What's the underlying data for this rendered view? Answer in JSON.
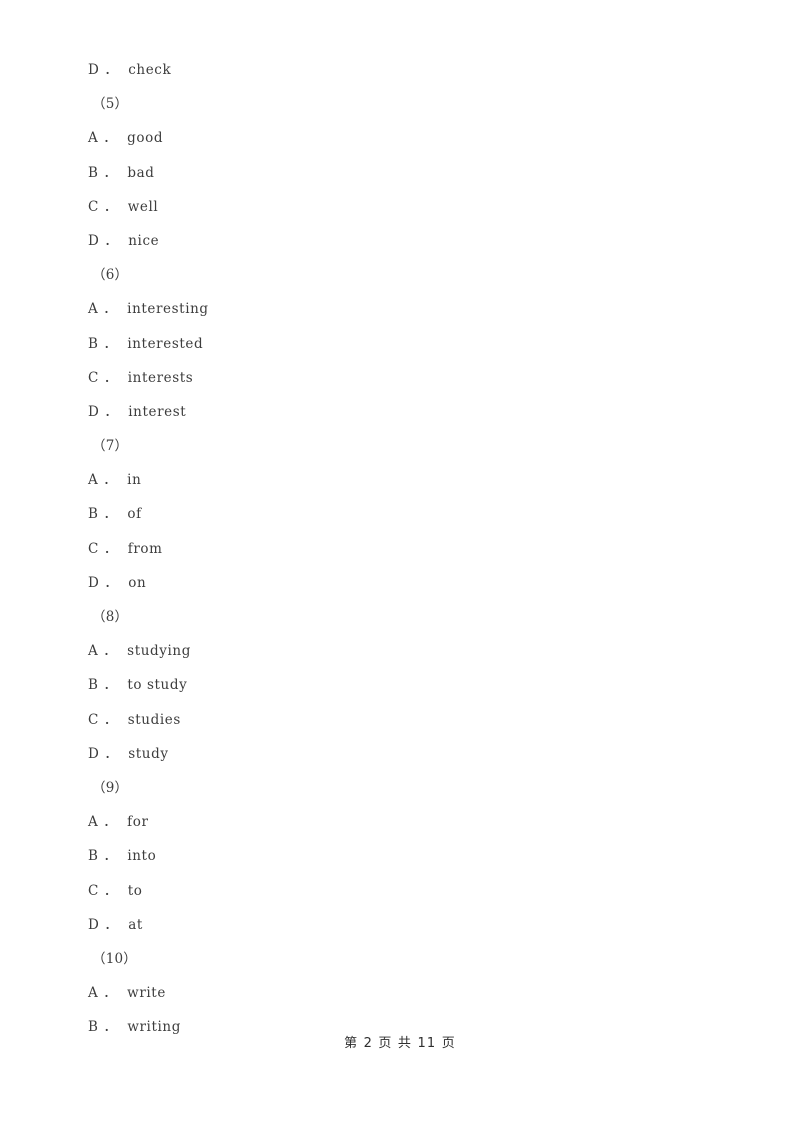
{
  "document": {
    "type": "exam-paper",
    "page_background": "#ffffff",
    "text_color": "#3d3d3d",
    "footer_color": "#2f2f2f"
  },
  "body": {
    "lines": [
      {
        "kind": "option",
        "letter": "D",
        "separator": "．",
        "text": "check"
      },
      {
        "kind": "group",
        "label": "（5）"
      },
      {
        "kind": "option",
        "letter": "A",
        "separator": "．",
        "text": "good"
      },
      {
        "kind": "option",
        "letter": "B",
        "separator": "．",
        "text": "bad"
      },
      {
        "kind": "option",
        "letter": "C",
        "separator": "．",
        "text": "well"
      },
      {
        "kind": "option",
        "letter": "D",
        "separator": "．",
        "text": "nice"
      },
      {
        "kind": "group",
        "label": "（6）"
      },
      {
        "kind": "option",
        "letter": "A",
        "separator": "．",
        "text": "interesting"
      },
      {
        "kind": "option",
        "letter": "B",
        "separator": "．",
        "text": "interested"
      },
      {
        "kind": "option",
        "letter": "C",
        "separator": "．",
        "text": "interests"
      },
      {
        "kind": "option",
        "letter": "D",
        "separator": "．",
        "text": "interest"
      },
      {
        "kind": "group",
        "label": "（7）"
      },
      {
        "kind": "option",
        "letter": "A",
        "separator": "．",
        "text": "in"
      },
      {
        "kind": "option",
        "letter": "B",
        "separator": "．",
        "text": "of"
      },
      {
        "kind": "option",
        "letter": "C",
        "separator": "．",
        "text": "from"
      },
      {
        "kind": "option",
        "letter": "D",
        "separator": "．",
        "text": "on"
      },
      {
        "kind": "group",
        "label": "（8）"
      },
      {
        "kind": "option",
        "letter": "A",
        "separator": "．",
        "text": "studying"
      },
      {
        "kind": "option",
        "letter": "B",
        "separator": "．",
        "text": "to study"
      },
      {
        "kind": "option",
        "letter": "C",
        "separator": "．",
        "text": "studies"
      },
      {
        "kind": "option",
        "letter": "D",
        "separator": "．",
        "text": "study"
      },
      {
        "kind": "group",
        "label": "（9）"
      },
      {
        "kind": "option",
        "letter": "A",
        "separator": "．",
        "text": "for"
      },
      {
        "kind": "option",
        "letter": "B",
        "separator": "．",
        "text": "into"
      },
      {
        "kind": "option",
        "letter": "C",
        "separator": "．",
        "text": "to"
      },
      {
        "kind": "option",
        "letter": "D",
        "separator": "．",
        "text": "at"
      },
      {
        "kind": "group",
        "label": "（10）"
      },
      {
        "kind": "option",
        "letter": "A",
        "separator": "．",
        "text": "write"
      },
      {
        "kind": "option",
        "letter": "B",
        "separator": "．",
        "text": "writing"
      }
    ]
  },
  "footer": {
    "text": "第 2 页 共 11 页",
    "page_number": "2",
    "total_pages": "11"
  }
}
